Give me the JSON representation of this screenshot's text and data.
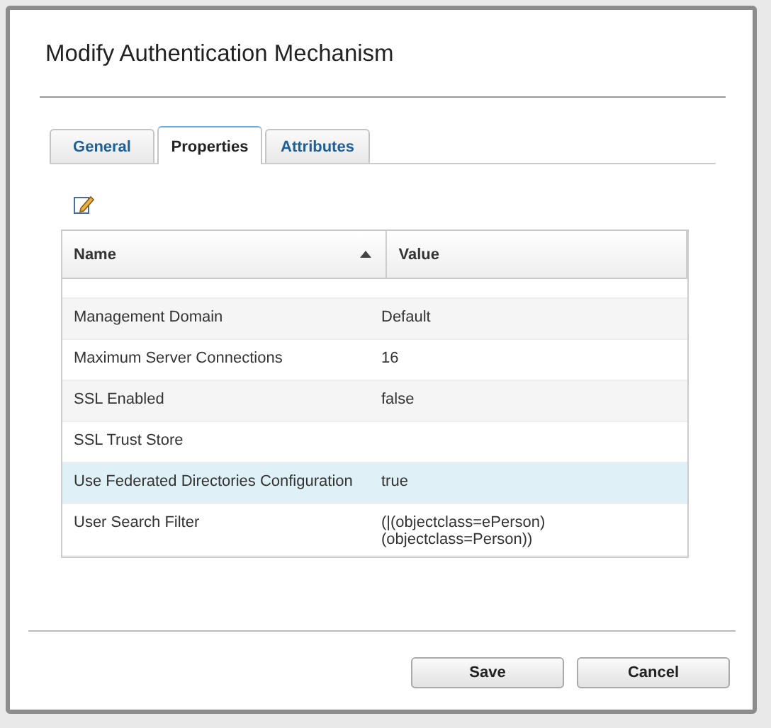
{
  "dialog": {
    "title": "Modify Authentication Mechanism"
  },
  "tabs": [
    {
      "label": "General",
      "selected": false
    },
    {
      "label": "Properties",
      "selected": true
    },
    {
      "label": "Attributes",
      "selected": false
    }
  ],
  "table": {
    "columns": [
      {
        "label": "Name",
        "sorted": true
      },
      {
        "label": "Value",
        "sorted": false
      }
    ],
    "rows": [
      {
        "name": "Management Domain",
        "value": "Default",
        "selected": false
      },
      {
        "name": "Maximum Server Connections",
        "value": "16",
        "selected": false
      },
      {
        "name": "SSL Enabled",
        "value": "false",
        "selected": false
      },
      {
        "name": "SSL Trust Store",
        "selected": false
      },
      {
        "name": "Use Federated Directories Configuration",
        "value": "true",
        "selected": true
      },
      {
        "name": "User Search Filter",
        "value": "(|(objectclass=ePerson)\n(objectclass=Person))",
        "selected": false
      }
    ]
  },
  "buttons": [
    "Save",
    "Cancel"
  ]
}
